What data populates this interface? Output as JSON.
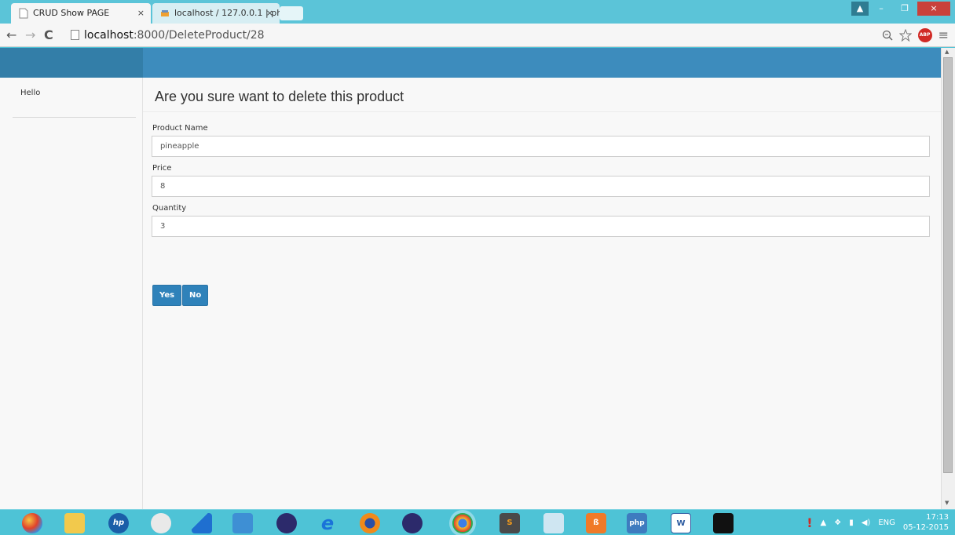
{
  "browser": {
    "tabs": [
      {
        "title": "CRUD Show PAGE",
        "close": "×"
      },
      {
        "title": "localhost / 127.0.0.1 | php",
        "close": "×"
      }
    ],
    "url_host": "localhost",
    "url_path": ":8000/DeleteProduct/28",
    "window_controls": {
      "user": "▲",
      "minimize": "–",
      "maximize": "❐",
      "close": "×"
    },
    "extensions": {
      "abp": "ABP"
    }
  },
  "sidebar": {
    "greeting": "Hello"
  },
  "main": {
    "heading": "Are you sure want to delete this product",
    "fields": [
      {
        "label": "Product Name",
        "value": "pineapple"
      },
      {
        "label": "Price",
        "value": "8"
      },
      {
        "label": "Quantity",
        "value": "3"
      }
    ],
    "buttons": {
      "yes": "Yes",
      "no": "No"
    }
  },
  "taskbar": {
    "apps": [
      "start-orb",
      "file-explorer",
      "hp",
      "snipping-tool",
      "sharkfin",
      "media-app",
      "eclipse",
      "internet-explorer",
      "firefox",
      "eclipse-2",
      "chrome",
      "sublime-text",
      "photos",
      "xampp",
      "php",
      "word",
      "command-prompt"
    ],
    "tray_lang": "ENG",
    "time": "17:13",
    "date": "05-12-2015"
  },
  "colors": {
    "header_blue": "#3d8cbd",
    "header_blue_dark": "#337ea8",
    "button_blue": "#2f82ba",
    "taskbar_cyan": "#4ec3d6"
  }
}
